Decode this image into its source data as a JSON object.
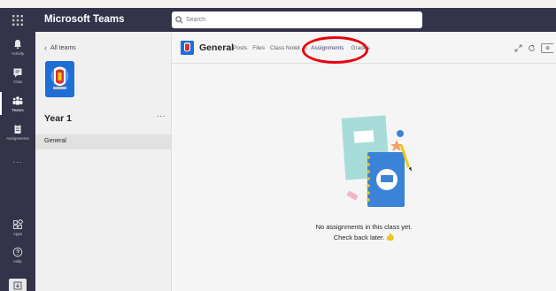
{
  "app": {
    "title": "Microsoft Teams"
  },
  "search": {
    "placeholder": "Search"
  },
  "rail": {
    "items": [
      {
        "label": "Activity"
      },
      {
        "label": "Chat"
      },
      {
        "label": "Teams"
      },
      {
        "label": "Assignments"
      },
      {
        "label": "Apps"
      },
      {
        "label": "Help"
      }
    ],
    "more": "..."
  },
  "team_panel": {
    "back_label": "All teams",
    "team_name": "Year 1",
    "more": "...",
    "channels": [
      {
        "label": "General"
      }
    ]
  },
  "channel": {
    "title": "General",
    "tabs": [
      {
        "label": "Posts"
      },
      {
        "label": "Files"
      },
      {
        "label": "Class Notebook"
      },
      {
        "label": "Assignments"
      },
      {
        "label": "Grades"
      }
    ]
  },
  "empty_state": {
    "line1": "No assignments in this class yet.",
    "line2": "Check back later."
  },
  "colors": {
    "rail": "#33344a",
    "accent": "#464775",
    "highlight": "#e8000d",
    "team_tile": "#1d6fd6"
  }
}
